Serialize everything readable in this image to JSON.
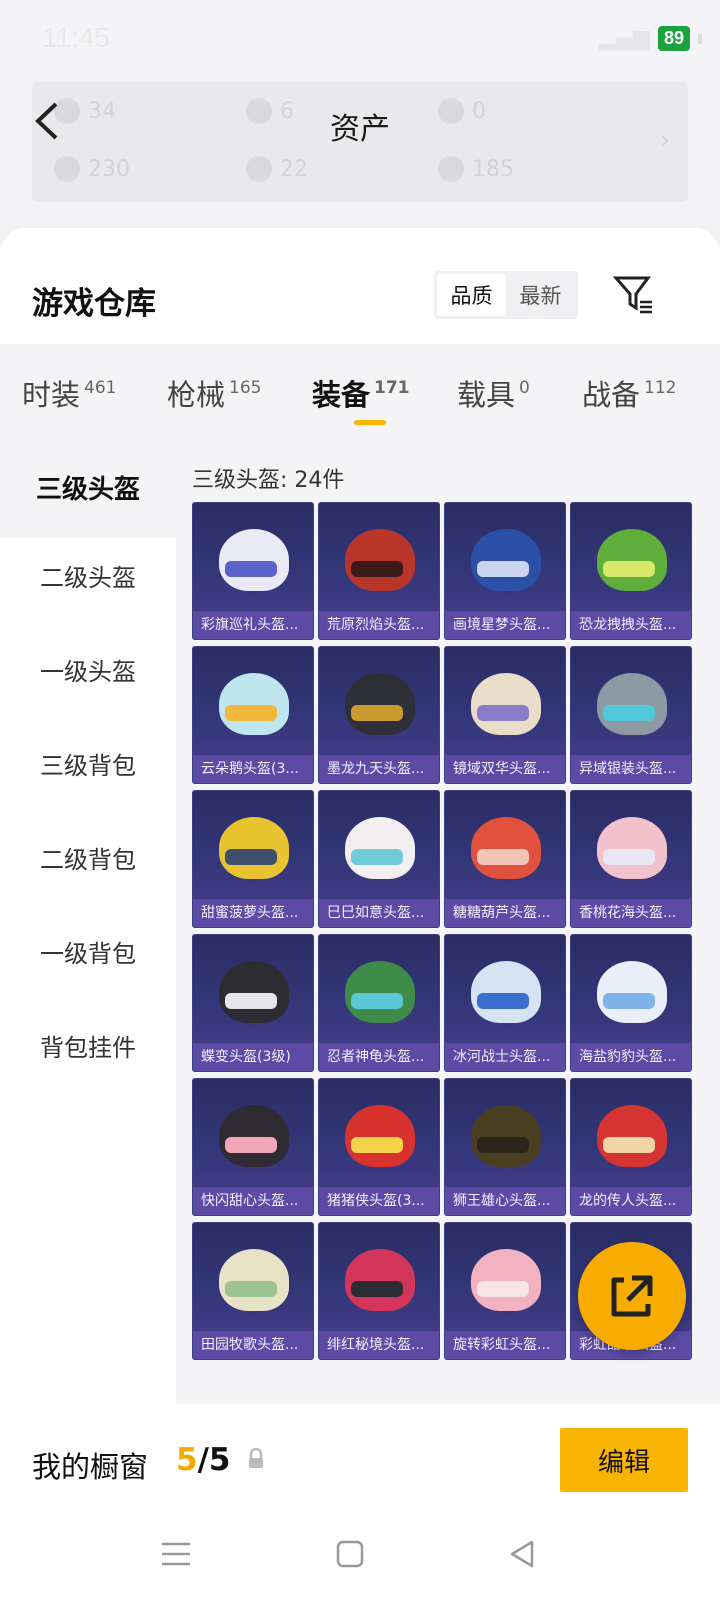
{
  "status": {
    "time": "11:45",
    "battery": "89",
    "colors": {
      "battery": "#1aa33c"
    }
  },
  "assets": {
    "title": "资产",
    "items": [
      {
        "value": "34",
        "icon": "coin-icon"
      },
      {
        "value": "6",
        "icon": "coin-icon"
      },
      {
        "value": "0",
        "icon": "coin-icon"
      },
      {
        "value": "230",
        "icon": "coin-icon"
      },
      {
        "value": "22",
        "icon": "coin-icon"
      },
      {
        "value": "185",
        "icon": "coin-icon"
      }
    ]
  },
  "warehouse": {
    "title": "游戏仓库",
    "sort": {
      "options": [
        "品质",
        "最新"
      ],
      "selected": "品质"
    }
  },
  "tabs": [
    {
      "label": "时装",
      "count": "461"
    },
    {
      "label": "枪械",
      "count": "165"
    },
    {
      "label": "装备",
      "count": "171",
      "active": true
    },
    {
      "label": "载具",
      "count": "0"
    },
    {
      "label": "战备",
      "count": "112"
    }
  ],
  "sidebar": {
    "items": [
      "三级头盔",
      "二级头盔",
      "一级头盔",
      "三级背包",
      "二级背包",
      "一级背包",
      "背包挂件"
    ],
    "active": "三级头盔"
  },
  "content": {
    "count_label": "三级头盔: 24件",
    "items": [
      {
        "name": "彩旗巡礼头盔...",
        "color": "#e9eaf5",
        "visor": "#5a63c8"
      },
      {
        "name": "荒原烈焰头盔...",
        "color": "#b8372a",
        "visor": "#3b1a17"
      },
      {
        "name": "画境星梦头盔...",
        "color": "#2c4fa8",
        "visor": "#c9d6ee"
      },
      {
        "name": "恐龙拽拽头盔...",
        "color": "#5fae3c",
        "visor": "#d7e86a"
      },
      {
        "name": "云朵鹅头盔(3...",
        "color": "#bfe6ee",
        "visor": "#f0b73a"
      },
      {
        "name": "墨龙九天头盔...",
        "color": "#2f2f38",
        "visor": "#c99a2e"
      },
      {
        "name": "镜域双华头盔...",
        "color": "#e9dcc8",
        "visor": "#8a7cc9"
      },
      {
        "name": "异域银装头盔...",
        "color": "#8e9aa3",
        "visor": "#4fc9d9"
      },
      {
        "name": "甜蜜菠萝头盔...",
        "color": "#e8c530",
        "visor": "#3d4f6b"
      },
      {
        "name": "巳巳如意头盔...",
        "color": "#f3eef0",
        "visor": "#6ecbd8"
      },
      {
        "name": "糖糖葫芦头盔...",
        "color": "#e0523e",
        "visor": "#f3c4b8"
      },
      {
        "name": "香桃花海头盔...",
        "color": "#f2c2cc",
        "visor": "#e8e6f2"
      },
      {
        "name": "蝶变头盔(3级)",
        "color": "#2d2d31",
        "visor": "#e6e6ea"
      },
      {
        "name": "忍者神龟头盔...",
        "color": "#3f8c4a",
        "visor": "#5bc8d8"
      },
      {
        "name": "冰河战士头盔...",
        "color": "#d6e3f4",
        "visor": "#3a6fd0"
      },
      {
        "name": "海盐豹豹头盔...",
        "color": "#e9eef9",
        "visor": "#7fb2e8"
      },
      {
        "name": "快闪甜心头盔...",
        "color": "#2f2b33",
        "visor": "#f2a6b8"
      },
      {
        "name": "猪猪侠头盔(3...",
        "color": "#d8322f",
        "visor": "#f4d34a"
      },
      {
        "name": "狮王雄心头盔...",
        "color": "#4a3e22",
        "visor": "#2a261c"
      },
      {
        "name": "龙的传人头盔...",
        "color": "#d53432",
        "visor": "#f1d3a5"
      },
      {
        "name": "田园牧歌头盔...",
        "color": "#e8e3c6",
        "visor": "#9cc38f"
      },
      {
        "name": "绯红秘境头盔...",
        "color": "#d4365b",
        "visor": "#2c2c33"
      },
      {
        "name": "旋转彩虹头盔...",
        "color": "#f3b2c0",
        "visor": "#f7e4e8"
      },
      {
        "name": "彩虹甜喵头盔...",
        "color": "#f5b7c4",
        "visor": "#ffffff"
      }
    ]
  },
  "showcase": {
    "label": "我的橱窗",
    "current": "5",
    "total": "/5",
    "edit_label": "编辑"
  },
  "icons": {
    "back": "back-arrow-icon",
    "filter": "filter-icon",
    "share": "share-icon",
    "lock": "lock-icon"
  },
  "colors": {
    "accent": "#f8b400",
    "card_bg": "#2f3270"
  }
}
